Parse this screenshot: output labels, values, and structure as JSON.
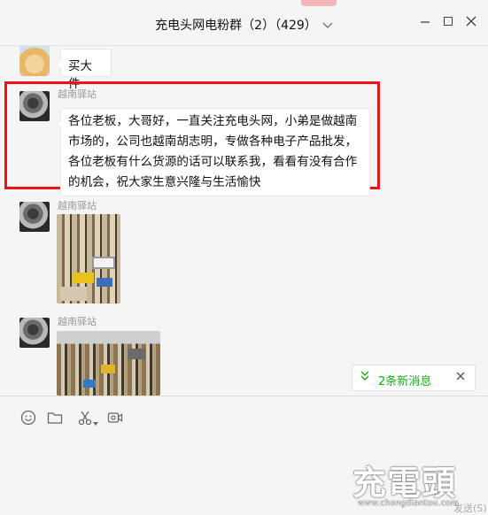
{
  "window": {
    "title": "充电头网电粉群（2）（429）",
    "title_dropdown_icon": "chevron-down-icon"
  },
  "messages": [
    {
      "type": "text",
      "sender": "",
      "text": "买大件",
      "avatar": "dog-avatar"
    },
    {
      "type": "text",
      "sender": "越南驿站",
      "text": "各位老板，大哥好，一直关注充电头网，小弟是做越南市场的，公司也越南胡志明，专做各种电子产品批发，各位老板有什么货源的话可以联系我，看看有没有合作的机会，祝大家生意兴隆与生活愉快",
      "highlighted": true,
      "highlight_color": "#e8141c"
    },
    {
      "type": "image",
      "sender": "越南驿站",
      "description": "photo-of-goods-1"
    },
    {
      "type": "image",
      "sender": "越南驿站",
      "description": "photo-of-goods-2"
    }
  ],
  "notification": {
    "new_messages_label": "2条新消息",
    "color": "#1aad19"
  },
  "toolbar": {
    "icons": [
      "emoji-icon",
      "folder-icon",
      "scissors-icon",
      "video-call-icon"
    ]
  },
  "watermark": {
    "big": "充電頭",
    "url": "www.chongdiantou.com"
  },
  "send_hint": "发送(S)"
}
